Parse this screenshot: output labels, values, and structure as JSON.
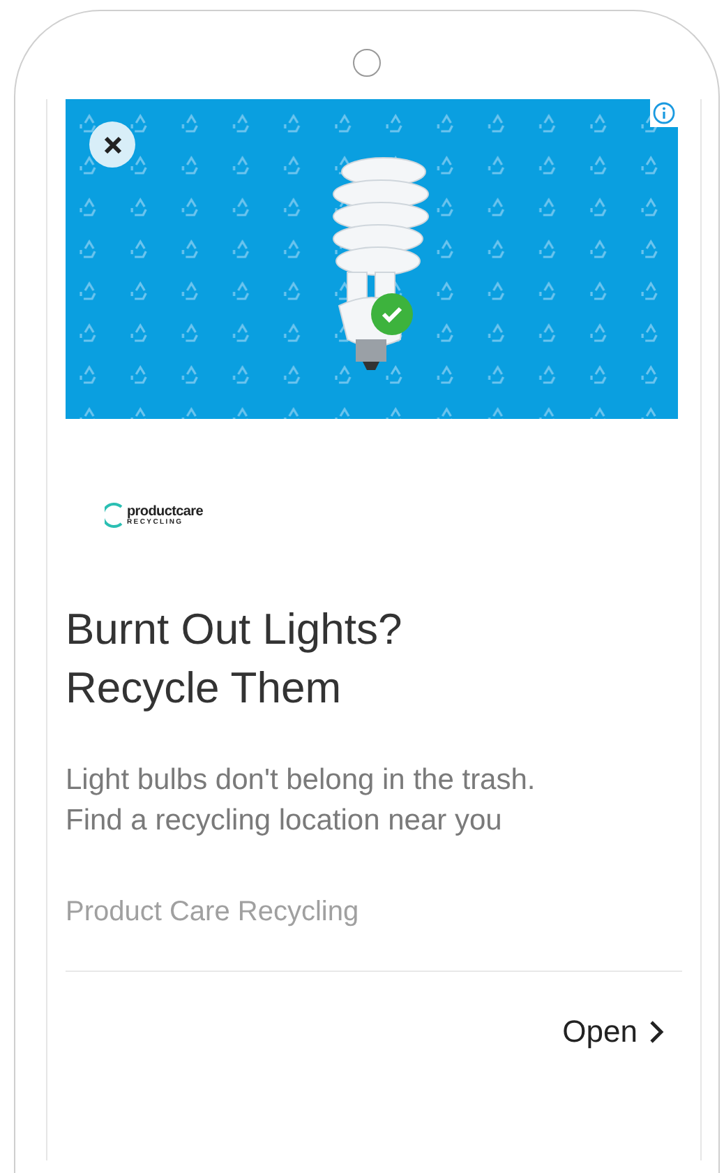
{
  "brand": {
    "name": "productcare",
    "tagline": "RECYCLING"
  },
  "headline": "Burnt Out Lights? Recycle Them",
  "body": "Light bulbs don't belong in the trash. Find a recycling location near you",
  "advertiser": "Product Care Recycling",
  "action": {
    "label": "Open"
  }
}
